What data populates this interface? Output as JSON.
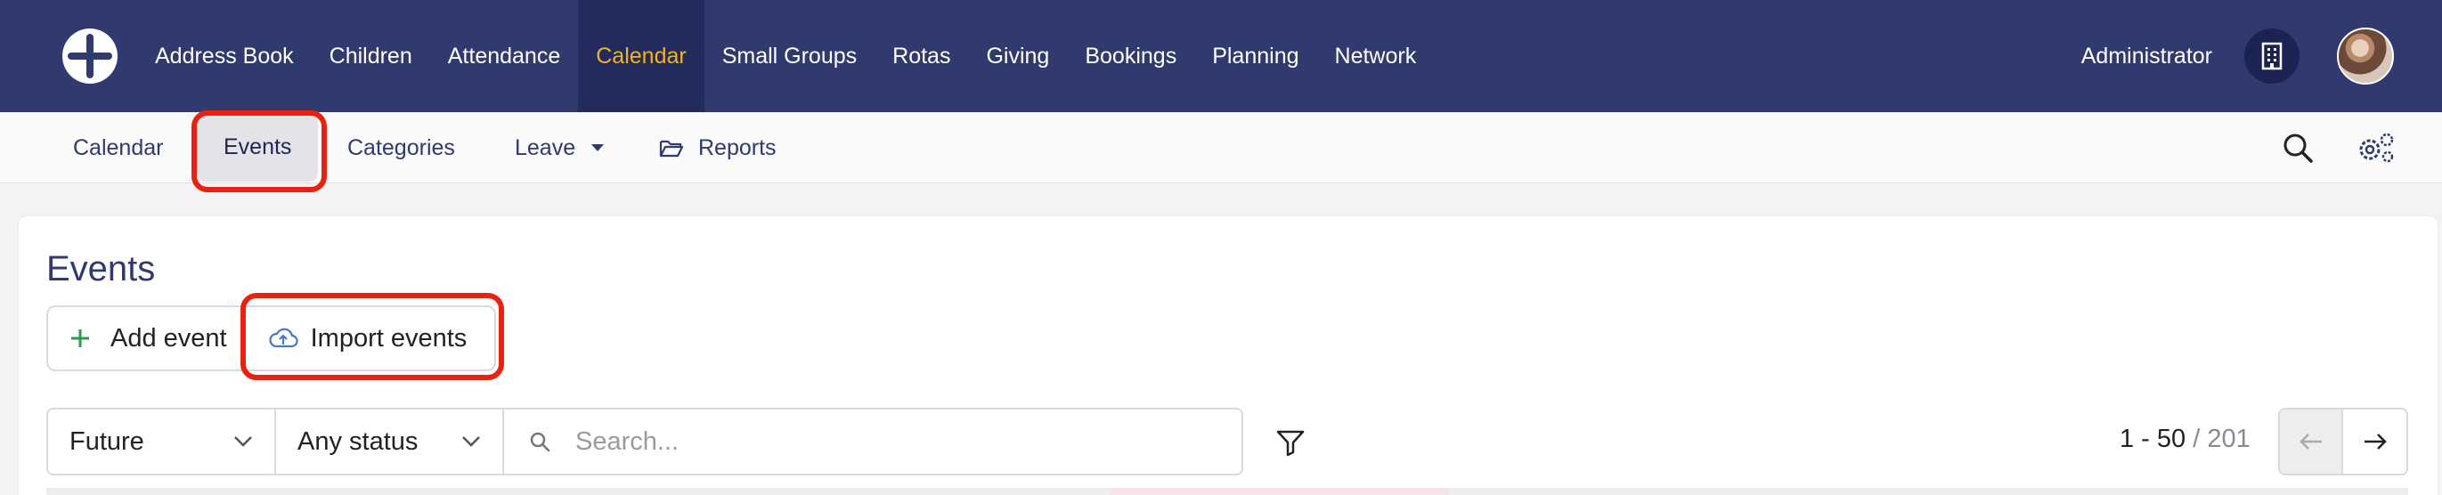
{
  "topnav": {
    "items": [
      {
        "label": "Address Book"
      },
      {
        "label": "Children"
      },
      {
        "label": "Attendance"
      },
      {
        "label": "Calendar"
      },
      {
        "label": "Small Groups"
      },
      {
        "label": "Rotas"
      },
      {
        "label": "Giving"
      },
      {
        "label": "Bookings"
      },
      {
        "label": "Planning"
      },
      {
        "label": "Network"
      }
    ],
    "active_item": "Calendar",
    "user_label": "Administrator"
  },
  "subnav": {
    "calendar": "Calendar",
    "events": "Events",
    "categories": "Categories",
    "leave": "Leave",
    "reports": "Reports"
  },
  "page": {
    "title": "Events",
    "add_event": "Add event",
    "import_events": "Import events"
  },
  "filters": {
    "time_value": "Future",
    "status_value": "Any status",
    "search_placeholder": "Search..."
  },
  "pagination": {
    "range": "1 - 50",
    "total": "/ 201"
  },
  "colors": {
    "nav_bg": "#303a6e",
    "active_nav": "#f0b323",
    "highlight": "#e8220e",
    "add_icon": "#2e9b4b"
  }
}
